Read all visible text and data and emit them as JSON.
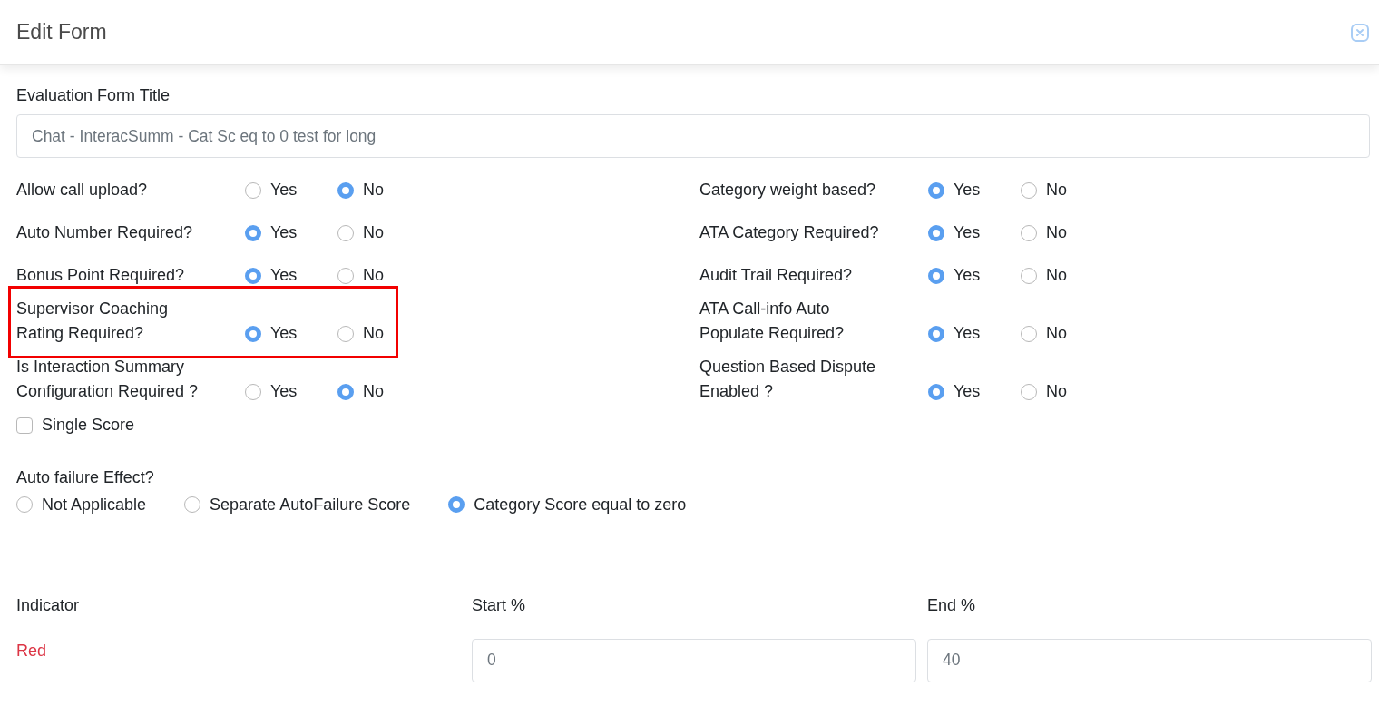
{
  "dialog": {
    "title": "Edit Form"
  },
  "form_title": {
    "label": "Evaluation Form Title",
    "value": "Chat - InteracSumm - Cat Sc eq to 0 test for long"
  },
  "left_questions": [
    {
      "label": "Allow call upload?",
      "highlighted": false,
      "options": [
        {
          "label": "Yes",
          "selected": false
        },
        {
          "label": "No",
          "selected": true
        }
      ]
    },
    {
      "label": "Auto Number Required?",
      "highlighted": false,
      "options": [
        {
          "label": "Yes",
          "selected": true
        },
        {
          "label": "No",
          "selected": false
        }
      ]
    },
    {
      "label": "Bonus Point Required?",
      "highlighted": false,
      "options": [
        {
          "label": "Yes",
          "selected": true
        },
        {
          "label": "No",
          "selected": false
        }
      ]
    },
    {
      "label": "Supervisor Coaching Rating Required?",
      "highlighted": true,
      "options": [
        {
          "label": "Yes",
          "selected": true
        },
        {
          "label": "No",
          "selected": false
        }
      ]
    },
    {
      "label": "Is Interaction Summary Configuration Required ?",
      "highlighted": false,
      "options": [
        {
          "label": "Yes",
          "selected": false
        },
        {
          "label": "No",
          "selected": true
        }
      ]
    }
  ],
  "right_questions": [
    {
      "label": "Category weight based?",
      "highlighted": false,
      "options": [
        {
          "label": "Yes",
          "selected": true
        },
        {
          "label": "No",
          "selected": false
        }
      ]
    },
    {
      "label": "ATA Category Required?",
      "highlighted": false,
      "options": [
        {
          "label": "Yes",
          "selected": true
        },
        {
          "label": "No",
          "selected": false
        }
      ]
    },
    {
      "label": "Audit Trail Required?",
      "highlighted": false,
      "options": [
        {
          "label": "Yes",
          "selected": true
        },
        {
          "label": "No",
          "selected": false
        }
      ]
    },
    {
      "label": "ATA Call-info Auto Populate Required?",
      "highlighted": false,
      "options": [
        {
          "label": "Yes",
          "selected": true
        },
        {
          "label": "No",
          "selected": false
        }
      ]
    },
    {
      "label": "Question Based Dispute Enabled ?",
      "highlighted": false,
      "options": [
        {
          "label": "Yes",
          "selected": true
        },
        {
          "label": "No",
          "selected": false
        }
      ]
    }
  ],
  "single_score": {
    "label": "Single Score",
    "checked": false
  },
  "auto_failure": {
    "label": "Auto failure Effect?",
    "options": [
      {
        "label": "Not Applicable",
        "selected": false
      },
      {
        "label": "Separate AutoFailure Score",
        "selected": false
      },
      {
        "label": "Category Score equal to zero",
        "selected": true
      }
    ]
  },
  "indicators": {
    "columns": [
      "Indicator",
      "Start %",
      "End %"
    ],
    "rows": [
      {
        "label": "Red",
        "color": "#dc3545",
        "start": "0",
        "end": "40"
      }
    ]
  }
}
